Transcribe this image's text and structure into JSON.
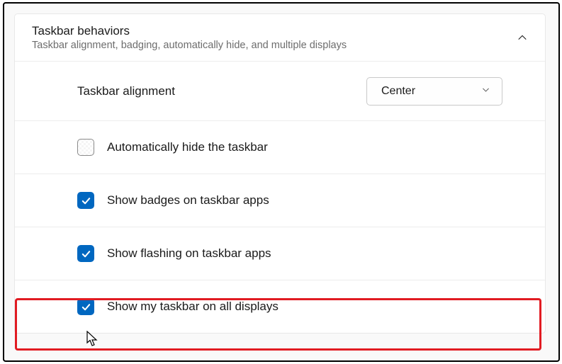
{
  "header": {
    "title": "Taskbar behaviors",
    "subtitle": "Taskbar alignment, badging, automatically hide, and multiple displays"
  },
  "alignment": {
    "label": "Taskbar alignment",
    "value": "Center"
  },
  "options": {
    "autoHide": {
      "label": "Automatically hide the taskbar",
      "checked": false
    },
    "badges": {
      "label": "Show badges on taskbar apps",
      "checked": true
    },
    "flashing": {
      "label": "Show flashing on taskbar apps",
      "checked": true
    },
    "allDisplays": {
      "label": "Show my taskbar on all displays",
      "checked": true
    }
  }
}
